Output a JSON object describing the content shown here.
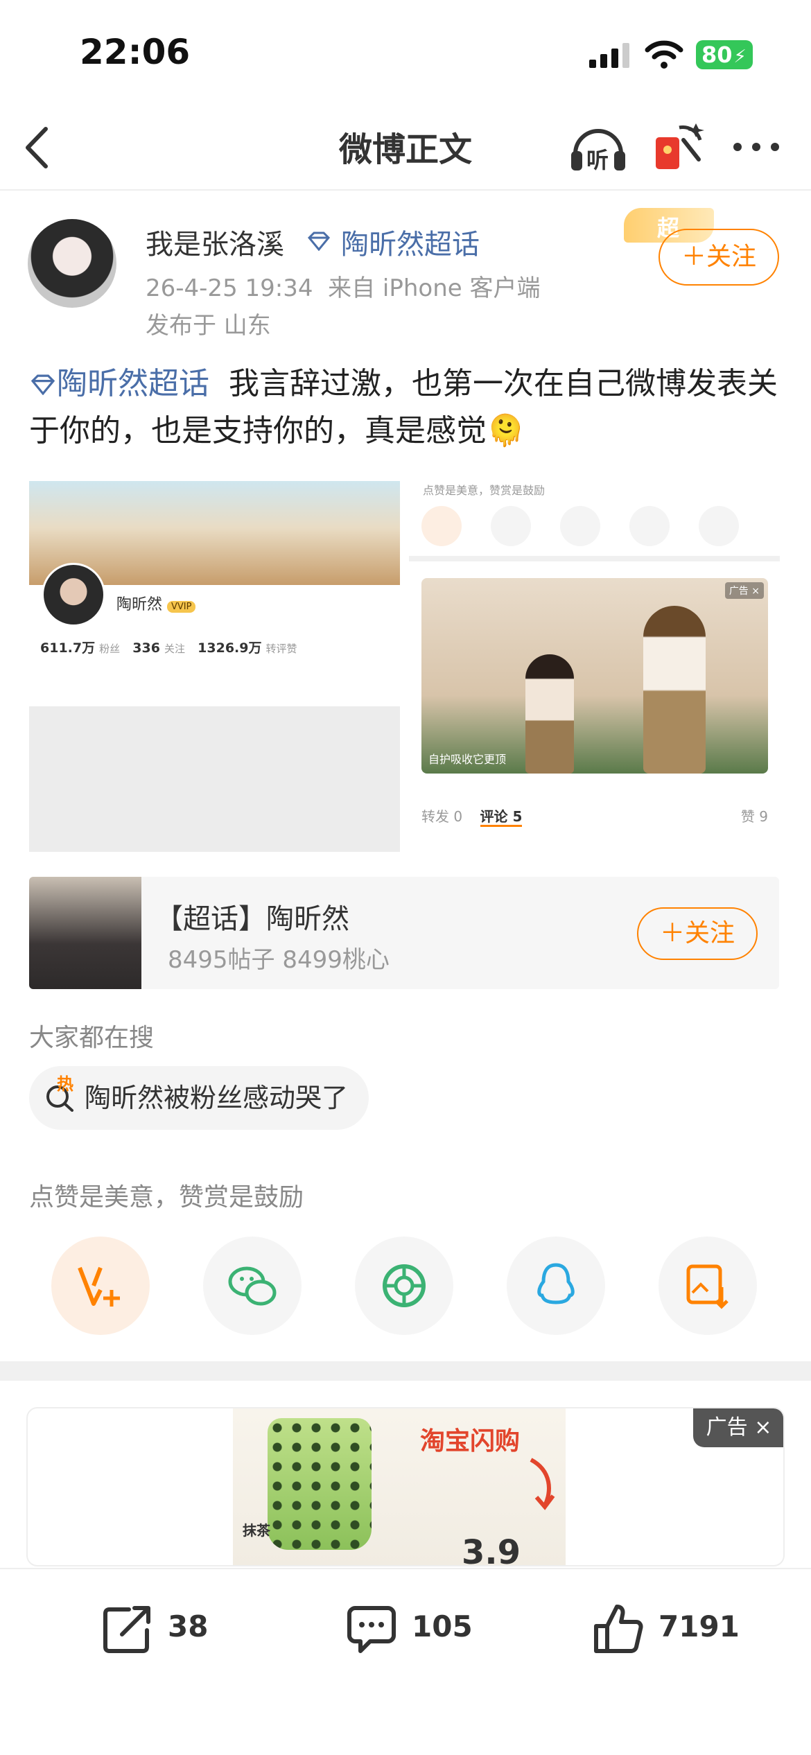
{
  "status_bar": {
    "time": "22:06",
    "battery": "80"
  },
  "nav": {
    "title": "微博正文",
    "listen_label": "听"
  },
  "post": {
    "username": "我是张洛溪",
    "super_tag": "陶昕然超话",
    "timestamp": "26-4-25 19:34",
    "source": "来自 iPhone 客户端",
    "location": "发布于 山东",
    "follow_label": "＋关注",
    "badge_label": "超",
    "body_tag": "陶昕然超话",
    "body_text": "我言辞过激，也第一次在自己微博发表关于你的，也是支持你的，真是感觉🫠"
  },
  "images": {
    "left": {
      "name": "陶昕然",
      "vip": "VVIP",
      "followers": "611.7万",
      "followers_label": "粉丝",
      "following": "336",
      "following_label": "关注",
      "reposts": "1326.9万",
      "reposts_label": "转评赞"
    },
    "right": {
      "hint": "点赞是美意，赞赏是鼓励",
      "ad_tag": "广告 ×",
      "video_caption": "自护吸收它更顶",
      "tab_repost": "转发 0",
      "tab_comment": "评论 5",
      "tab_like": "赞 9"
    }
  },
  "topic_card": {
    "title": "【超话】陶昕然",
    "meta": "8495帖子 8499桃心",
    "follow_label": "＋关注"
  },
  "search": {
    "label": "大家都在搜",
    "chip": "陶昕然被粉丝感动哭了",
    "hot_badge": "热"
  },
  "share": {
    "hint": "点赞是美意，赞赏是鼓励",
    "colors": {
      "orange": "#ff8200",
      "wechat": "#3bb273",
      "qq": "#2aa8e0"
    }
  },
  "ad": {
    "label": "广告 ×",
    "headline": "淘宝闪购",
    "product": "抹茶",
    "price_hint": "3.9"
  },
  "bottom_bar": {
    "repost_count": "38",
    "comment_count": "105",
    "like_count": "7191"
  }
}
